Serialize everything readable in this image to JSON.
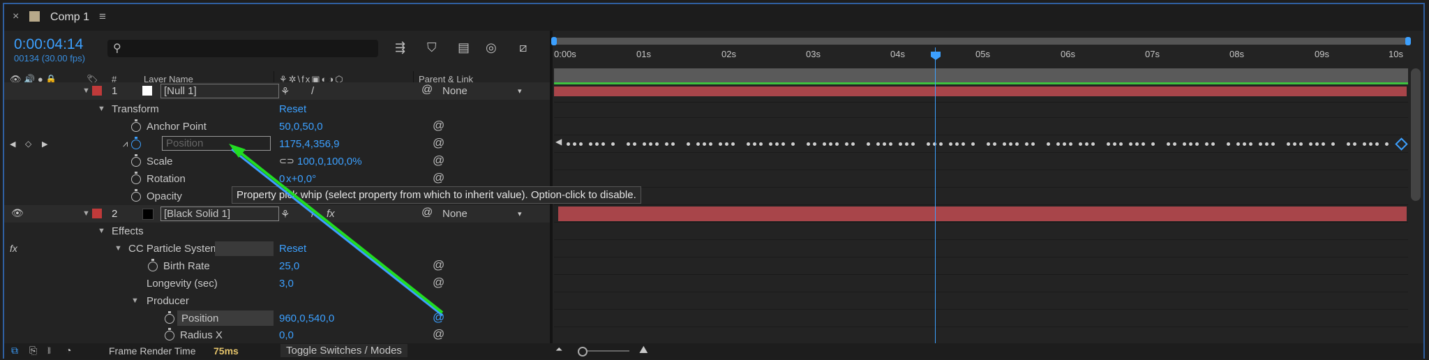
{
  "tab": {
    "title": "Comp 1"
  },
  "header": {
    "timecode": "0:00:04:14",
    "frame_info": "00134 (30.00 fps)",
    "search_placeholder": "",
    "col_layer_name": "Layer Name",
    "col_number": "#",
    "col_parent": "Parent & Link"
  },
  "ruler": {
    "ticks": [
      "0:00s",
      "01s",
      "02s",
      "03s",
      "04s",
      "05s",
      "06s",
      "07s",
      "08s",
      "09s",
      "10s"
    ]
  },
  "layers": {
    "l1": {
      "number": "1",
      "name": "[Null 1]",
      "parent": "None",
      "color": "#c03a3a"
    },
    "l2": {
      "number": "2",
      "name": "[Black Solid 1]",
      "parent": "None",
      "color": "#c03a3a"
    }
  },
  "props": {
    "transform": "Transform",
    "reset1": "Reset",
    "anchor": {
      "label": "Anchor Point",
      "value": "50,0,50,0"
    },
    "position": {
      "label": "Position",
      "value": "1175,4,356,9"
    },
    "scale": {
      "label": "Scale",
      "value": "100,0,100,0%"
    },
    "rotation": {
      "label": "Rotation",
      "value_a": "0",
      "value_b": "x+0,0°"
    },
    "opacity": {
      "label": "Opacity"
    },
    "effects": "Effects",
    "cc": "CC Particle Systems II",
    "reset2": "Reset",
    "birth": {
      "label": "Birth Rate",
      "value": "25,0"
    },
    "longevity": {
      "label": "Longevity (sec)",
      "value": "3,0"
    },
    "producer": "Producer",
    "p_position": {
      "label": "Position",
      "value": "960,0,540,0"
    },
    "radius": {
      "label": "Radius X",
      "value": "0,0"
    }
  },
  "tooltip": "Property pick whip (select property from which to inherit value). Option-click to disable.",
  "footer": {
    "render_label": "Frame Render Time",
    "render_value": "75ms",
    "toggle": "Toggle Switches / Modes"
  },
  "colors": {
    "accent": "#3ca0ff",
    "layer_bar": "#a8454a",
    "work_area": "#3ec23e",
    "arrow": "#22dd22"
  }
}
